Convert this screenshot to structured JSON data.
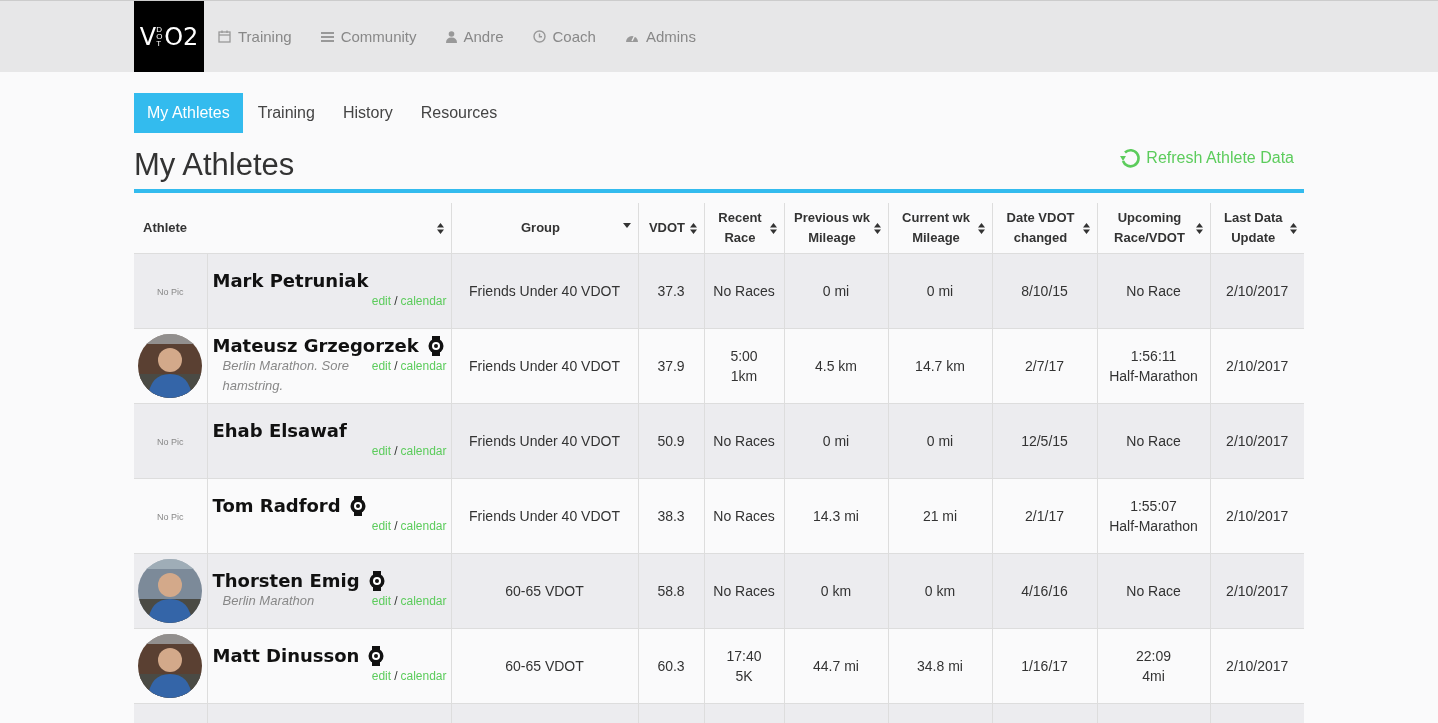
{
  "logo": {
    "main": "V",
    "sub": "DOT",
    "tail": "O2"
  },
  "topnav": [
    {
      "label": "Training"
    },
    {
      "label": "Community"
    },
    {
      "label": "Andre"
    },
    {
      "label": "Coach"
    },
    {
      "label": "Admins"
    }
  ],
  "tabs": [
    {
      "label": "My Athletes",
      "selected": true
    },
    {
      "label": "Training",
      "selected": false
    },
    {
      "label": "History",
      "selected": false
    },
    {
      "label": "Resources",
      "selected": false
    }
  ],
  "page_title": "My Athletes",
  "refresh_link": "Refresh Athlete Data",
  "table": {
    "columns": [
      {
        "label": "Athlete",
        "sorted": false
      },
      {
        "label": "Group",
        "sorted": true
      },
      {
        "label": "VDOT",
        "sorted": false
      },
      {
        "label": "Recent Race",
        "sorted": false
      },
      {
        "label": "Previous wk Mileage",
        "sorted": false
      },
      {
        "label": "Current wk Mileage",
        "sorted": false
      },
      {
        "label": "Date VDOT changed",
        "sorted": false
      },
      {
        "label": "Upcoming Race/VDOT",
        "sorted": false
      },
      {
        "label": "Last Data Update",
        "sorted": false
      }
    ],
    "rows": [
      {
        "no_pic": "No Pic",
        "links": [
          "edit",
          "/",
          "calendar"
        ],
        "name": "Mark Petruniak",
        "device": false,
        "group": "Friends Under 40 VDOT",
        "vdot": "37.3",
        "recent_race": [
          "No Races"
        ],
        "prev_mileage": "0 mi",
        "curr_mileage": "0 mi",
        "date_changed": "8/10/15",
        "upcoming": [
          "No Race"
        ],
        "last_update": "2/10/2017"
      },
      {
        "links": [
          "edit",
          "/",
          "calendar"
        ],
        "name": "Mateusz Grzegorzek",
        "device": true,
        "note": "Berlin Marathon. Sore hamstring.",
        "group": "Friends Under 40 VDOT",
        "vdot": "37.9",
        "recent_race": [
          "5:00",
          "1km"
        ],
        "prev_mileage": "4.5 km",
        "curr_mileage": "14.7 km",
        "date_changed": "2/7/17",
        "upcoming": [
          "1:56:11",
          "Half-Marathon"
        ],
        "last_update": "2/10/2017"
      },
      {
        "no_pic": "No Pic",
        "links": [
          "edit",
          "/",
          "calendar"
        ],
        "name": "Ehab Elsawaf",
        "device": false,
        "group": "Friends Under 40 VDOT",
        "vdot": "50.9",
        "recent_race": [
          "No Races"
        ],
        "prev_mileage": "0 mi",
        "curr_mileage": "0 mi",
        "date_changed": "12/5/15",
        "upcoming": [
          "No Race"
        ],
        "last_update": "2/10/2017"
      },
      {
        "no_pic": "No Pic",
        "links": [
          "edit",
          "/",
          "calendar"
        ],
        "name": "Tom Radford",
        "device": true,
        "group": "Friends Under 40 VDOT",
        "vdot": "38.3",
        "recent_race": [
          "No Races"
        ],
        "prev_mileage": "14.3 mi",
        "curr_mileage": "21 mi",
        "date_changed": "2/1/17",
        "upcoming": [
          "1:55:07",
          "Half-Marathon"
        ],
        "last_update": "2/10/2017"
      },
      {
        "links": [
          "edit",
          "/",
          "calendar"
        ],
        "name": "Thorsten Emig",
        "device": true,
        "note": "Berlin Marathon",
        "group": "60-65 VDOT",
        "vdot": "58.8",
        "recent_race": [
          "No Races"
        ],
        "prev_mileage": "0 km",
        "curr_mileage": "0 km",
        "date_changed": "4/16/16",
        "upcoming": [
          "No Race"
        ],
        "last_update": "2/10/2017"
      },
      {
        "links": [
          "edit",
          "/",
          "calendar"
        ],
        "name": "Matt Dinusson",
        "device": true,
        "group": "60-65 VDOT",
        "vdot": "60.3",
        "recent_race": [
          "17:40",
          "5K"
        ],
        "prev_mileage": "44.7 mi",
        "curr_mileage": "34.8 mi",
        "date_changed": "1/16/17",
        "upcoming": [
          "22:09",
          "4mi"
        ],
        "last_update": "2/10/2017"
      }
    ]
  }
}
